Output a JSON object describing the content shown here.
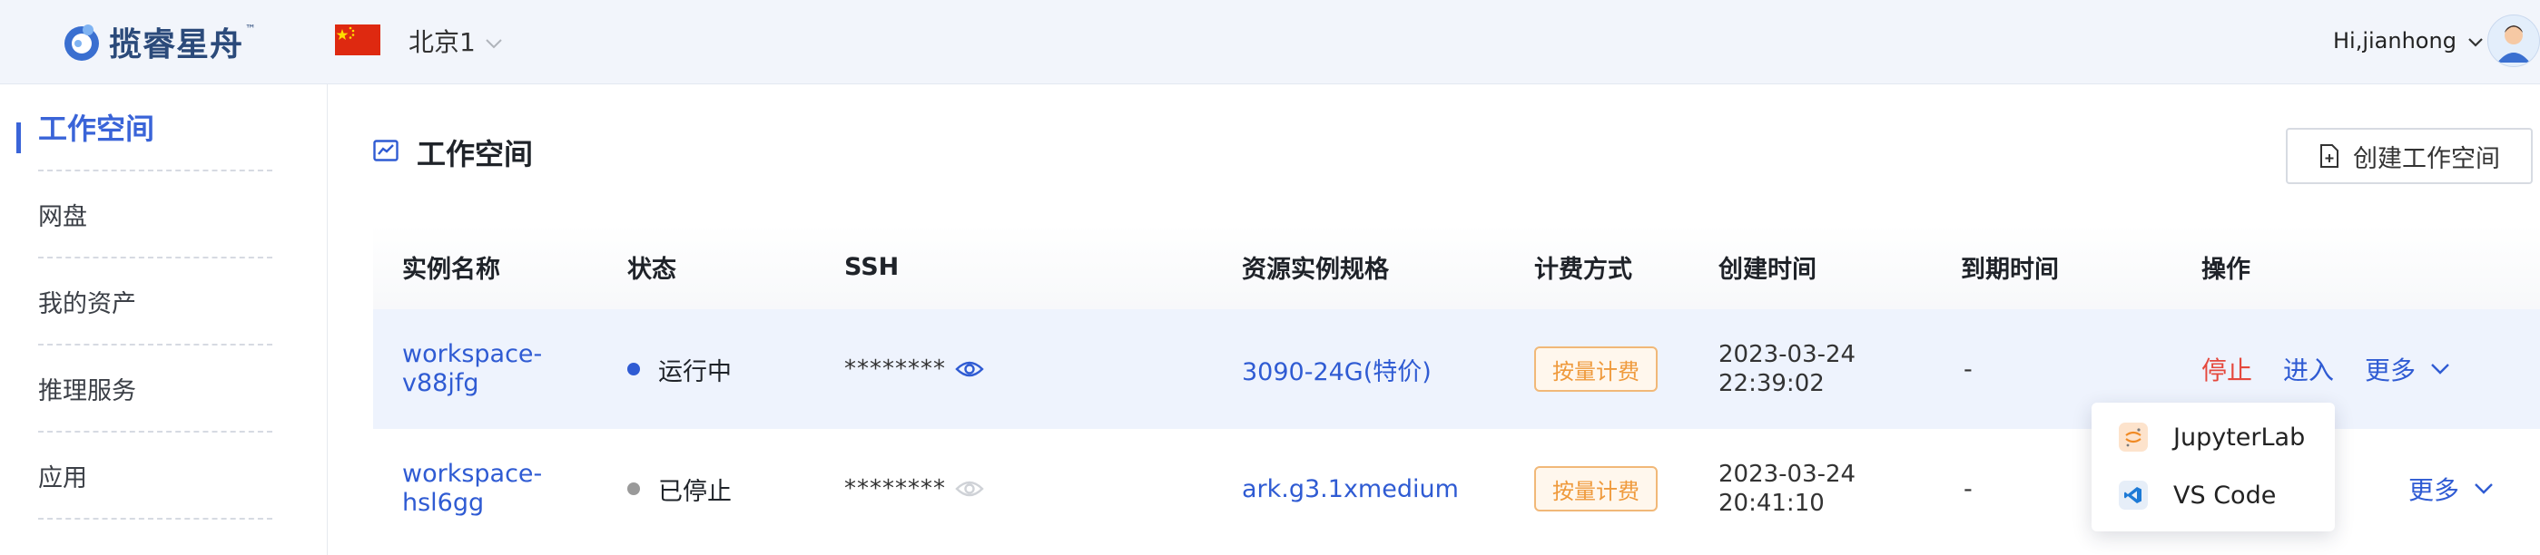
{
  "header": {
    "logo_text": "揽睿星舟",
    "logo_tm": "™",
    "region": "北京1",
    "greeting": "Hi,jianhong"
  },
  "sidebar": {
    "items": [
      {
        "label": "工作空间",
        "active": true
      },
      {
        "label": "网盘"
      },
      {
        "label": "我的资产"
      },
      {
        "label": "推理服务"
      },
      {
        "label": "应用"
      }
    ]
  },
  "main": {
    "title": "工作空间",
    "create_label": "创建工作空间"
  },
  "table": {
    "columns": [
      "实例名称",
      "状态",
      "SSH",
      "资源实例规格",
      "计费方式",
      "创建时间",
      "到期时间",
      "操作"
    ],
    "rows": [
      {
        "name_line1": "workspace-",
        "name_line2": "v88jfg",
        "status": "运行中",
        "status_color": "#2f5bd3",
        "ssh": "********",
        "spec": "3090-24G(特价)",
        "billing": "按量计费",
        "created_date": "2023-03-24",
        "created_time": "22:39:02",
        "expire": "-",
        "op_stop": "停止",
        "op_enter": "进入",
        "op_more": "更多"
      },
      {
        "name_line1": "workspace-",
        "name_line2": "hsl6gg",
        "status": "已停止",
        "status_color": "#9a9a9a",
        "ssh": "********",
        "spec": "ark.g3.1xmedium",
        "billing": "按量计费",
        "created_date": "2023-03-24",
        "created_time": "20:41:10",
        "expire": "-",
        "op_more": "更多"
      }
    ]
  },
  "dropdown": {
    "items": [
      {
        "label": "JupyterLab",
        "icon": "jupyter-icon"
      },
      {
        "label": "VS Code",
        "icon": "vscode-icon"
      }
    ]
  },
  "colors": {
    "accent": "#3a64d8",
    "link": "#2f5bd3",
    "stop": "#e5483d",
    "badge": "#ef9a3c"
  }
}
